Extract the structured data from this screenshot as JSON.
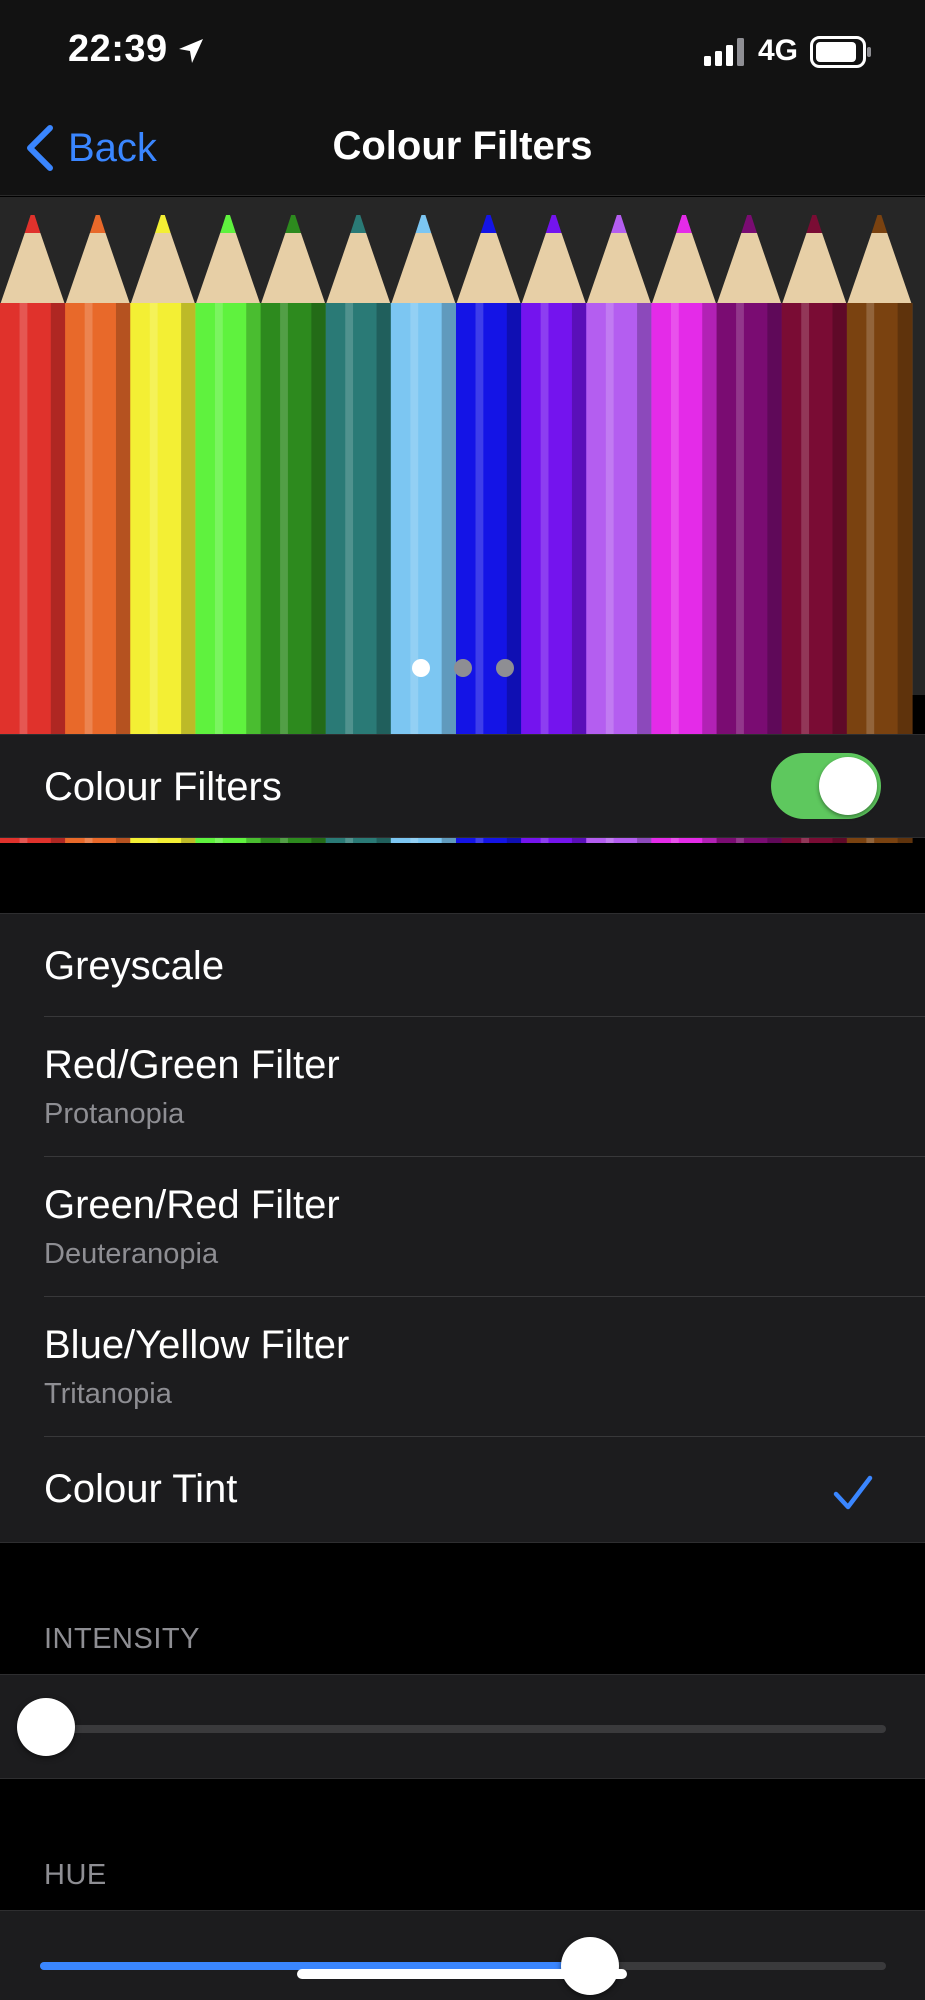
{
  "status_bar": {
    "time": "22:39",
    "network": "4G",
    "icons": [
      "location-arrow-icon",
      "signal-bars-icon",
      "battery-icon"
    ]
  },
  "nav": {
    "back_label": "Back",
    "title": "Colour Filters"
  },
  "preview": {
    "pencil_colors": [
      "#e0322c",
      "#e8692a",
      "#f3ef34",
      "#5ff23e",
      "#2d8a1e",
      "#2a7a76",
      "#7cc6f2",
      "#1414e6",
      "#7414ee",
      "#b45ef0",
      "#e42be8",
      "#7a0c72",
      "#7a0c34",
      "#7a4210"
    ],
    "page_count": 3,
    "current_page": 1
  },
  "colour_filters_toggle": {
    "label": "Colour Filters",
    "on": true
  },
  "filter_options": [
    {
      "label": "Greyscale",
      "sublabel": "",
      "selected": false
    },
    {
      "label": "Red/Green Filter",
      "sublabel": "Protanopia",
      "selected": false
    },
    {
      "label": "Green/Red Filter",
      "sublabel": "Deuteranopia",
      "selected": false
    },
    {
      "label": "Blue/Yellow Filter",
      "sublabel": "Tritanopia",
      "selected": false
    },
    {
      "label": "Colour Tint",
      "sublabel": "",
      "selected": true
    }
  ],
  "intensity": {
    "header": "INTENSITY",
    "value": 0.0
  },
  "hue": {
    "header": "HUE",
    "value": 0.65
  },
  "colors": {
    "accent": "#3a86ff",
    "toggle_on": "#5ec85e",
    "cell_bg": "#1c1c1e",
    "secondary_text": "#8e8e93"
  }
}
